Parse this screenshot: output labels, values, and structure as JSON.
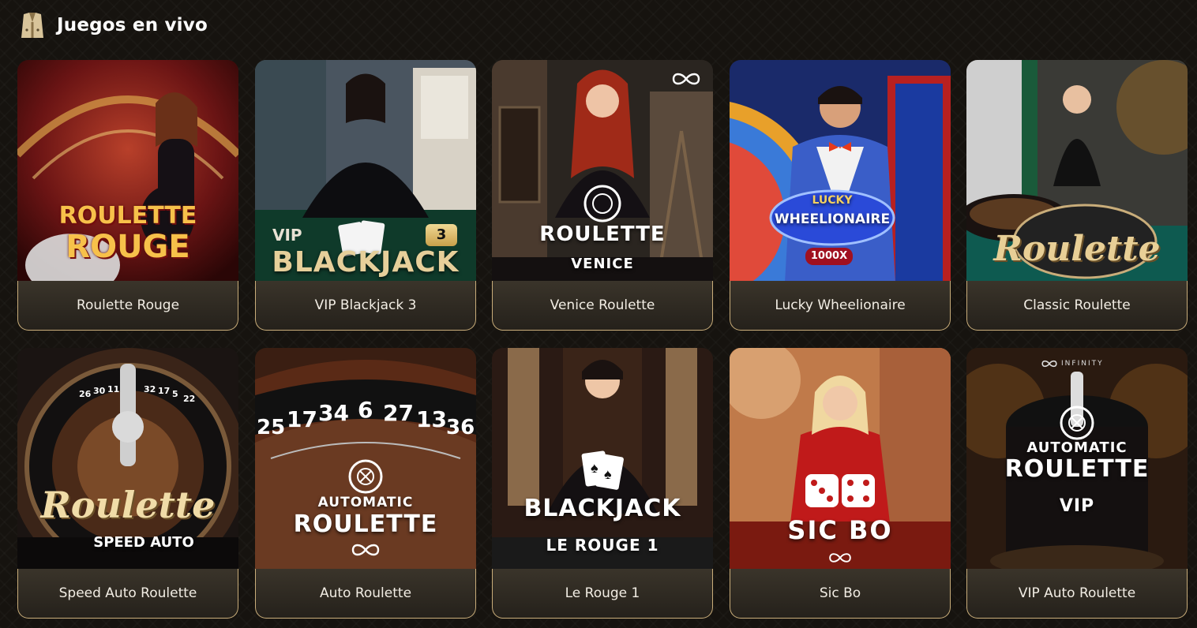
{
  "header": {
    "title": "Juegos en vivo",
    "icon": "dealer-vest-icon"
  },
  "games": [
    {
      "caption": "Roulette Rouge",
      "logo": [
        "ROULETTE",
        "ROUGE"
      ]
    },
    {
      "caption": "VIP Blackjack 3",
      "logo": [
        "VIP",
        "BLACKJACK",
        "3"
      ]
    },
    {
      "caption": "Venice Roulette",
      "logo": [
        "ROULETTE",
        "VENICE"
      ]
    },
    {
      "caption": "Lucky Wheelionaire",
      "logo": [
        "LUCKY",
        "WHEELIONAIRE",
        "1000X"
      ]
    },
    {
      "caption": "Classic Roulette",
      "logo": [
        "Roulette"
      ]
    },
    {
      "caption": "Speed Auto Roulette",
      "logo": [
        "Roulette",
        "SPEED AUTO"
      ]
    },
    {
      "caption": "Auto Roulette",
      "logo": [
        "AUTOMATIC",
        "ROULETTE"
      ]
    },
    {
      "caption": "Le Rouge 1",
      "logo": [
        "BLACKJACK",
        "LE ROUGE 1"
      ]
    },
    {
      "caption": "Sic Bo",
      "logo": [
        "SIC BO"
      ]
    },
    {
      "caption": "VIP Auto Roulette",
      "logo": [
        "INFINITY",
        "AUTOMATIC",
        "ROULETTE",
        "VIP"
      ]
    }
  ],
  "roulette_numbers_speed": [
    "26",
    "30",
    "11",
    "32",
    "17",
    "5",
    "22"
  ],
  "roulette_numbers_auto": [
    "25",
    "17",
    "34",
    "6",
    "27",
    "13",
    "36"
  ],
  "colors": {
    "gold": "#c9ad7a",
    "background": "#16130f",
    "red": "#c0121e"
  }
}
